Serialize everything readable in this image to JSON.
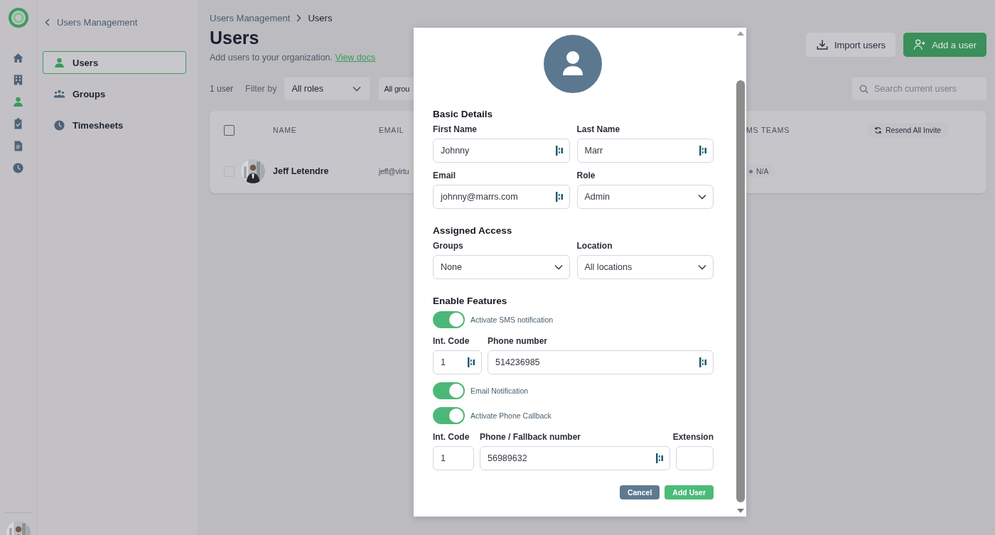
{
  "rail": {
    "items": [
      {
        "kind": "home",
        "selected": false
      },
      {
        "kind": "building",
        "selected": false
      },
      {
        "kind": "person",
        "selected": true
      },
      {
        "kind": "clipboard",
        "selected": false
      },
      {
        "kind": "document",
        "selected": false
      },
      {
        "kind": "clock",
        "selected": false
      }
    ]
  },
  "sidebar": {
    "back_label": "Users Management",
    "items": [
      {
        "kind": "person",
        "label": "Users",
        "selected": true
      },
      {
        "kind": "group",
        "label": "Groups",
        "selected": false
      },
      {
        "kind": "clock",
        "label": "Timesheets",
        "selected": false
      }
    ]
  },
  "breadcrumb": [
    "Users Management",
    "Users"
  ],
  "page": {
    "title": "Users",
    "subtitle": "Add users to your organization.",
    "link": "View docs"
  },
  "actions": [
    {
      "kind": "import",
      "label": "Import users"
    },
    {
      "kind": "add",
      "label": "Add a user"
    }
  ],
  "toolbar": {
    "count": "1 user",
    "filter_label": "Filter by",
    "filters": [
      "All roles",
      "All grou"
    ],
    "search": {
      "placeholder": "Search current users"
    }
  },
  "table": {
    "select_all": {
      "checked": false
    },
    "columns": [
      "NAME",
      "EMAIL",
      "MS TEAMS"
    ],
    "resend": "Resend All Invite",
    "rows": [
      {
        "checked": false,
        "name": "Jeff Letendre",
        "email": "jeff@virtu",
        "teams": "N/A"
      }
    ]
  },
  "modal": {
    "sections": [
      {
        "title": "Basic Details",
        "items": [
          {
            "kind": "fields",
            "fields": [
              {
                "kind": "text",
                "label": "First Name",
                "value": "Johnny"
              },
              {
                "kind": "text",
                "label": "Last Name",
                "value": "Marr"
              }
            ]
          },
          {
            "kind": "fields",
            "fields": [
              {
                "kind": "text",
                "label": "Email",
                "value": "johnny@marrs.com"
              },
              {
                "kind": "select",
                "label": "Role",
                "value": "Admin"
              }
            ]
          }
        ]
      },
      {
        "title": "Assigned Access",
        "items": [
          {
            "kind": "fields",
            "fields": [
              {
                "kind": "select",
                "label": "Groups",
                "value": "None"
              },
              {
                "kind": "select",
                "label": "Location",
                "value": "All locations"
              }
            ]
          }
        ]
      },
      {
        "title": "Enable Features",
        "items": [
          {
            "kind": "toggle",
            "label": "Activate SMS notification",
            "on": true
          },
          {
            "kind": "fields",
            "fields": [
              {
                "kind": "code",
                "label": "Int. Code",
                "value": "1"
              },
              {
                "kind": "text",
                "label": "Phone number",
                "value": "514236985"
              }
            ]
          },
          {
            "kind": "toggle",
            "label": "Email Notification",
            "on": true
          },
          {
            "kind": "toggle",
            "label": "Activate Phone Callback",
            "on": true
          },
          {
            "kind": "fields",
            "fields": [
              {
                "kind": "short",
                "label": "Int. Code",
                "value": "1"
              },
              {
                "kind": "text",
                "label": "Phone / Fallback number",
                "value": "56989632"
              },
              {
                "kind": "extension",
                "label": "Extension"
              }
            ]
          }
        ]
      }
    ],
    "buttons": [
      {
        "kind": "secondary",
        "label": "Cancel"
      },
      {
        "kind": "primary",
        "label": "Add User"
      }
    ]
  }
}
